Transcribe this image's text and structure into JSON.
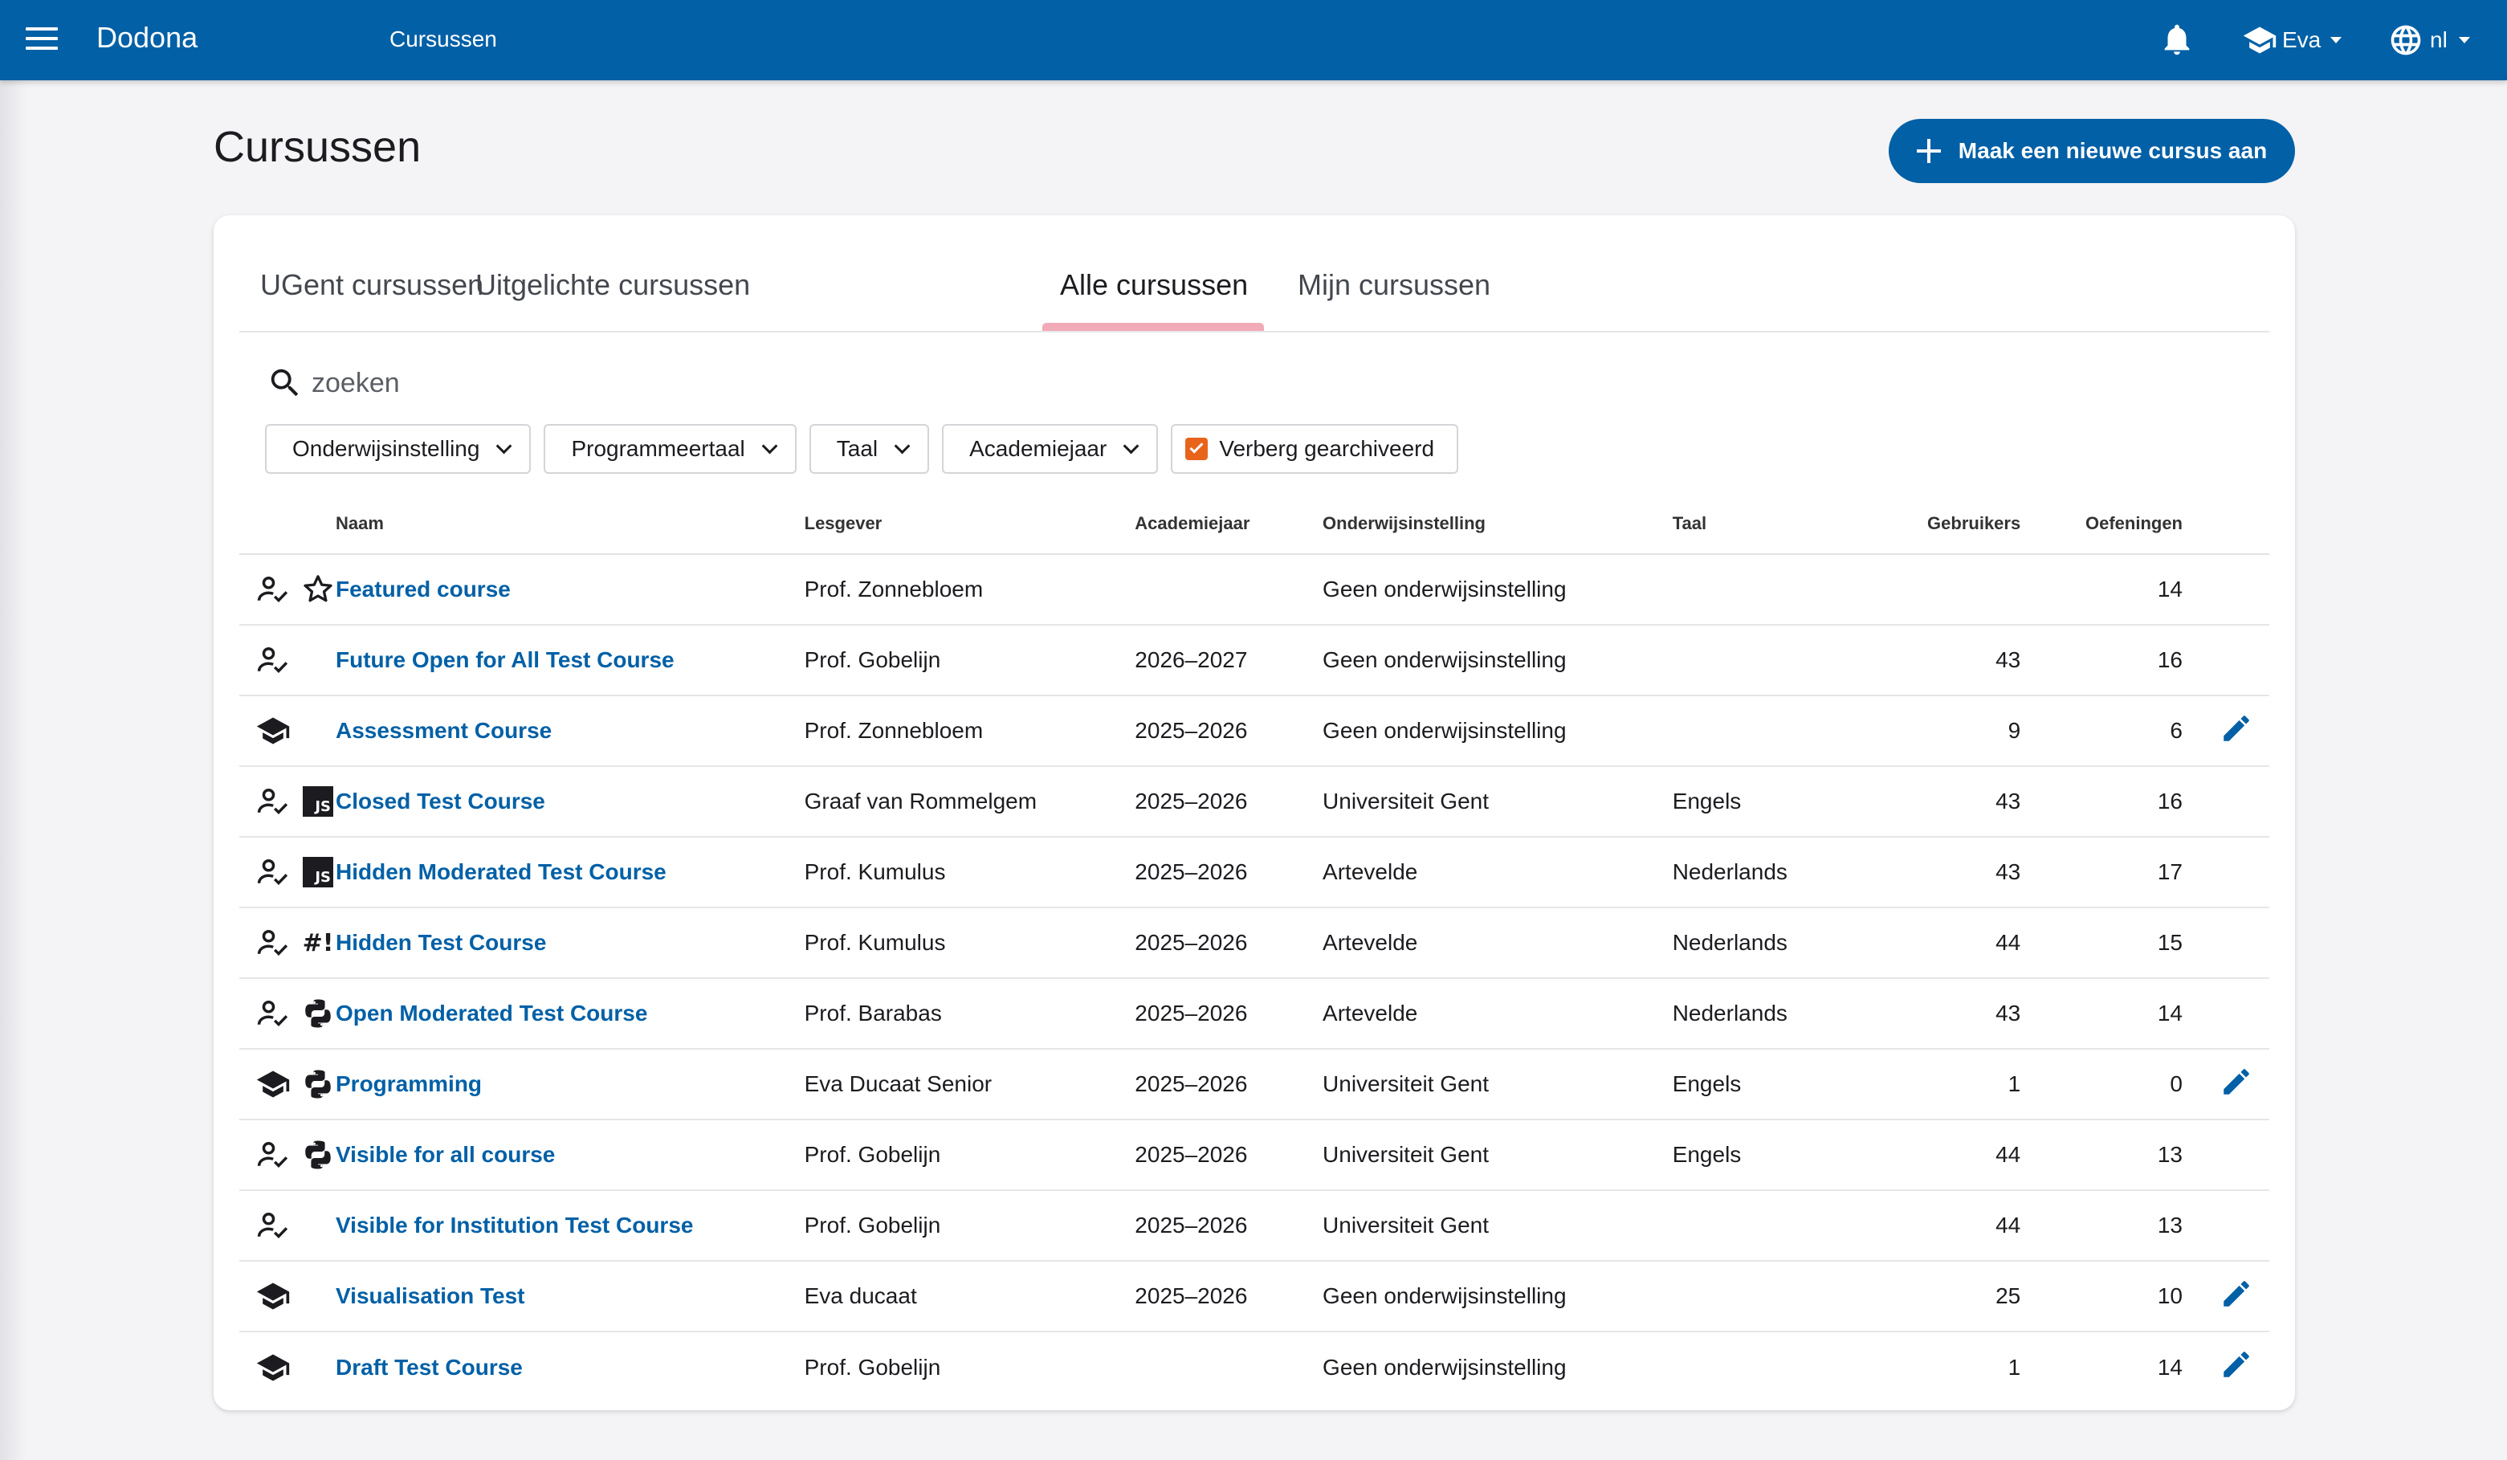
{
  "header": {
    "app_title": "Dodona",
    "breadcrumb": "Cursussen",
    "user_name": "Eva",
    "language": "nl"
  },
  "page": {
    "title": "Cursussen",
    "new_course_label": "Maak een nieuwe cursus aan"
  },
  "tabs": [
    {
      "label": "UGent cursussen",
      "active": false
    },
    {
      "label": "Uitgelichte cursussen",
      "active": false
    },
    {
      "label": "Alle cursussen",
      "active": true
    },
    {
      "label": "Mijn cursussen",
      "active": false
    }
  ],
  "search": {
    "placeholder": "zoeken"
  },
  "filters": {
    "institution": "Onderwijsinstelling",
    "programming_language": "Programmeertaal",
    "language": "Taal",
    "academic_year": "Academiejaar",
    "hide_archived": "Verberg gearchiveerd",
    "hide_archived_checked": true
  },
  "table": {
    "headers": {
      "name": "Naam",
      "teacher": "Lesgever",
      "year": "Academiejaar",
      "institution": "Onderwijsinstelling",
      "language": "Taal",
      "users": "Gebruikers",
      "exercises": "Oefeningen"
    },
    "rows": [
      {
        "icons": [
          "user-check-icon",
          "star-icon"
        ],
        "name": "Featured course",
        "teacher": "Prof. Zonnebloem",
        "year": "",
        "institution": "Geen onderwijsinstelling",
        "language": "",
        "users": "",
        "exercises": "14",
        "editable": false
      },
      {
        "icons": [
          "user-check-icon"
        ],
        "name": "Future Open for All Test Course",
        "teacher": "Prof. Gobelijn",
        "year": "2026–2027",
        "institution": "Geen onderwijsinstelling",
        "language": "",
        "users": "43",
        "exercises": "16",
        "editable": false
      },
      {
        "icons": [
          "graduation-cap-icon"
        ],
        "name": "Assessment Course",
        "teacher": "Prof. Zonnebloem",
        "year": "2025–2026",
        "institution": "Geen onderwijsinstelling",
        "language": "",
        "users": "9",
        "exercises": "6",
        "editable": true
      },
      {
        "icons": [
          "user-check-icon",
          "javascript-icon"
        ],
        "name": "Closed Test Course",
        "teacher": "Graaf van Rommelgem",
        "year": "2025–2026",
        "institution": "Universiteit Gent",
        "language": "Engels",
        "users": "43",
        "exercises": "16",
        "editable": false
      },
      {
        "icons": [
          "user-check-icon",
          "javascript-icon"
        ],
        "name": "Hidden Moderated Test Course",
        "teacher": "Prof. Kumulus",
        "year": "2025–2026",
        "institution": "Artevelde",
        "language": "Nederlands",
        "users": "43",
        "exercises": "17",
        "editable": false
      },
      {
        "icons": [
          "user-check-icon",
          "bash-icon"
        ],
        "name": "Hidden Test Course",
        "teacher": "Prof. Kumulus",
        "year": "2025–2026",
        "institution": "Artevelde",
        "language": "Nederlands",
        "users": "44",
        "exercises": "15",
        "editable": false
      },
      {
        "icons": [
          "user-check-icon",
          "python-icon"
        ],
        "name": "Open Moderated Test Course",
        "teacher": "Prof. Barabas",
        "year": "2025–2026",
        "institution": "Artevelde",
        "language": "Nederlands",
        "users": "43",
        "exercises": "14",
        "editable": false
      },
      {
        "icons": [
          "graduation-cap-icon",
          "python-icon"
        ],
        "name": "Programming",
        "teacher": "Eva Ducaat Senior",
        "year": "2025–2026",
        "institution": "Universiteit Gent",
        "language": "Engels",
        "users": "1",
        "exercises": "0",
        "editable": true
      },
      {
        "icons": [
          "user-check-icon",
          "python-icon"
        ],
        "name": "Visible for all course",
        "teacher": "Prof. Gobelijn",
        "year": "2025–2026",
        "institution": "Universiteit Gent",
        "language": "Engels",
        "users": "44",
        "exercises": "13",
        "editable": false
      },
      {
        "icons": [
          "user-check-icon"
        ],
        "name": "Visible for Institution Test Course",
        "teacher": "Prof. Gobelijn",
        "year": "2025–2026",
        "institution": "Universiteit Gent",
        "language": "",
        "users": "44",
        "exercises": "13",
        "editable": false
      },
      {
        "icons": [
          "graduation-cap-icon"
        ],
        "name": "Visualisation Test",
        "teacher": "Eva ducaat",
        "year": "2025–2026",
        "institution": "Geen onderwijsinstelling",
        "language": "",
        "users": "25",
        "exercises": "10",
        "editable": true
      },
      {
        "icons": [
          "graduation-cap-icon"
        ],
        "name": "Draft Test Course",
        "teacher": "Prof. Gobelijn",
        "year": "",
        "institution": "Geen onderwijsinstelling",
        "language": "",
        "users": "1",
        "exercises": "14",
        "editable": true
      }
    ]
  },
  "colors": {
    "primary": "#0160a6",
    "tab_indicator": "#f3aab8",
    "checkbox": "#e8641b",
    "background": "#f4f4f6"
  }
}
